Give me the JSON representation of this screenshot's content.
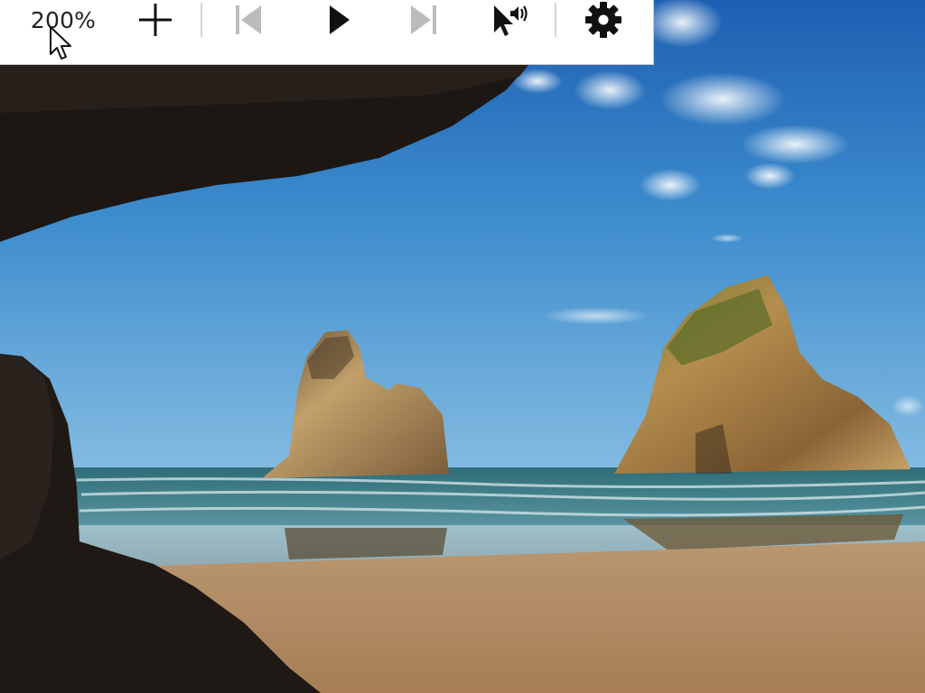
{
  "magnifier_toolbar": {
    "zoom_level": "200%",
    "buttons": [
      {
        "name": "zoom-in",
        "icon": "plus-icon",
        "enabled": true
      },
      {
        "name": "previous",
        "icon": "skip-back-icon",
        "enabled": false
      },
      {
        "name": "play",
        "icon": "play-icon",
        "enabled": true
      },
      {
        "name": "next",
        "icon": "skip-forward-icon",
        "enabled": false
      },
      {
        "name": "read-from-here",
        "icon": "pointer-speaker-icon",
        "enabled": true
      },
      {
        "name": "settings",
        "icon": "gear-icon",
        "enabled": true
      }
    ]
  },
  "colors": {
    "toolbar_bg": "#ffffff",
    "icon_enabled": "#111111",
    "icon_disabled": "#bcbcbc",
    "separator": "#d4d4d4",
    "sky_top": "#1f63b4",
    "sky_bottom": "#79b6e0",
    "sea": "#3f7f84",
    "sand": "#b08860",
    "cave_rock": "#1c1714",
    "sea_stack": "#9c7a48"
  }
}
